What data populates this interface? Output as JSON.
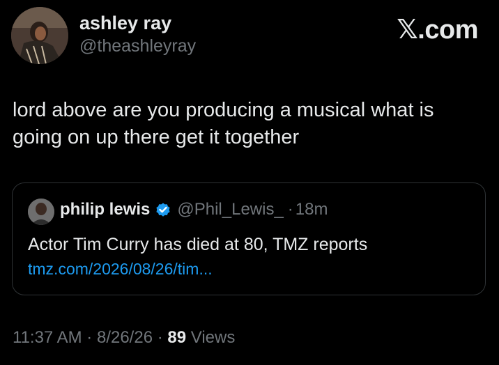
{
  "author": {
    "display_name": "ashley ray",
    "handle": "@theashleyray"
  },
  "brand": {
    "label": "𝕏.com"
  },
  "tweet": {
    "text_lines": [
      "lord above are you producing a musical what is",
      "going on up there get it together"
    ]
  },
  "quoted_tweet": {
    "display_name": "philip lewis",
    "handle": "@Phil_Lewis_",
    "separator": "·",
    "time": "18m",
    "text": "Actor Tim Curry has died at 80, TMZ reports",
    "link": "tmz.com/2026/08/26/tim...",
    "verified_icon": "verified-badge-icon"
  },
  "meta": {
    "time": "11:37 AM",
    "sep1": "·",
    "date": "8/26/26",
    "sep2": "·",
    "views_count": "89",
    "views_label": "Views"
  },
  "colors": {
    "background": "#000000",
    "text": "#e7e9ea",
    "muted": "#71767b",
    "link": "#1d9bf0",
    "border": "#2f3336"
  }
}
